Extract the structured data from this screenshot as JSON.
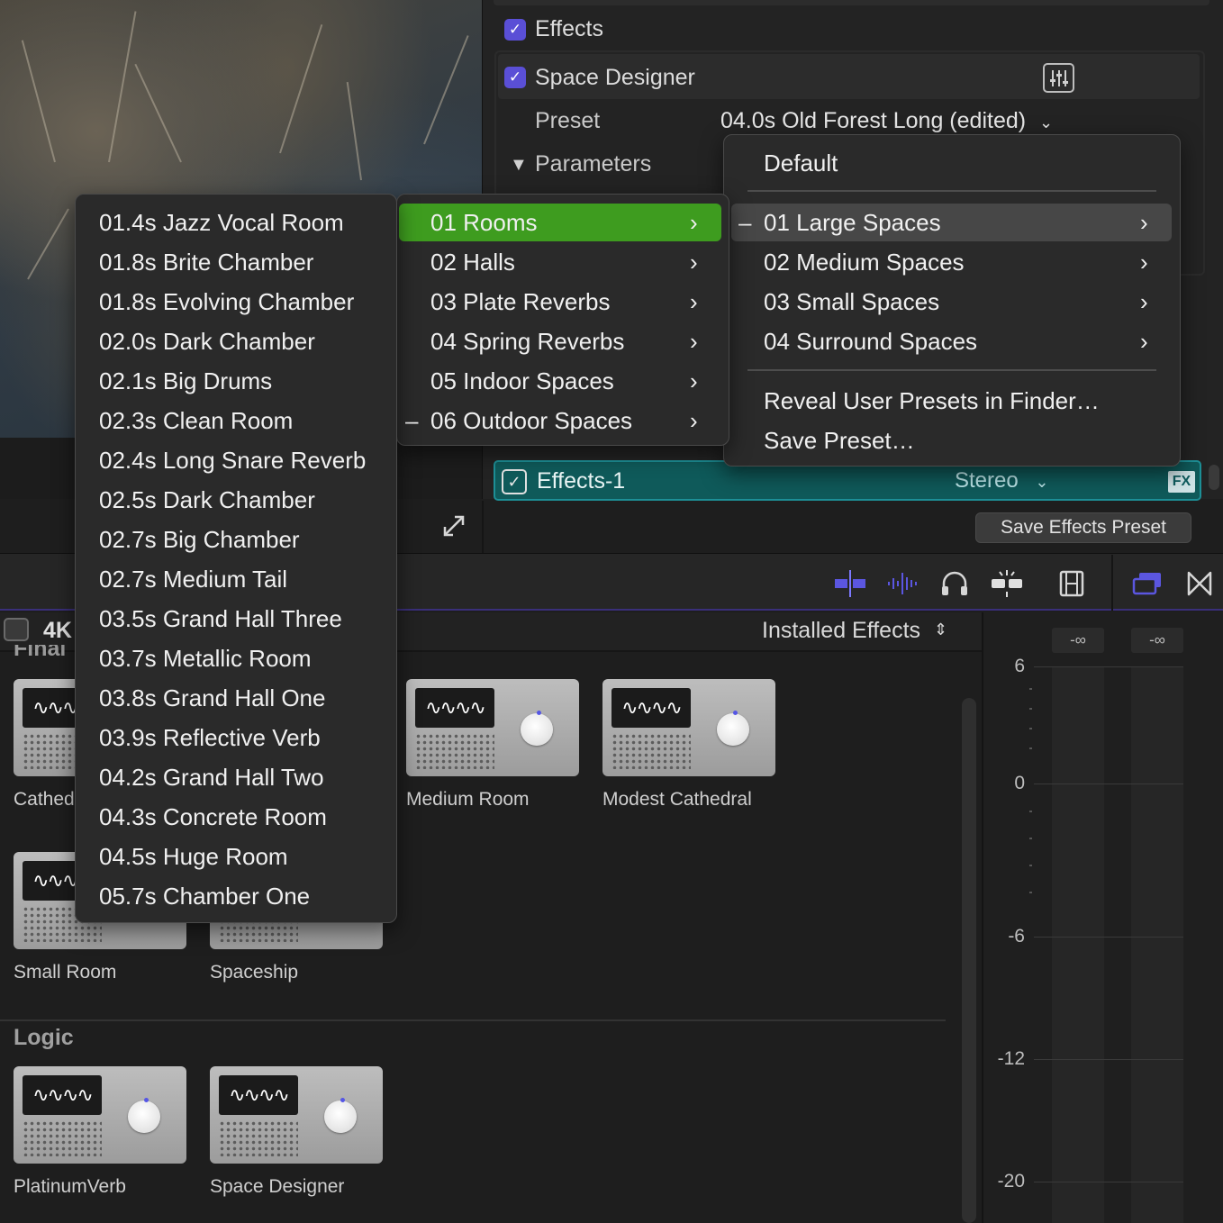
{
  "inspector": {
    "effects_label": "Effects",
    "space_designer_label": "Space Designer",
    "preset_label": "Preset",
    "preset_value": "04.0s Old Forest Long (edited)",
    "parameters_label": "Parameters",
    "effects1_label": "Effects-1",
    "channel_label": "Stereo",
    "fx_badge": "FX",
    "save_button": "Save Effects Preset"
  },
  "browser": {
    "partial_label": "4K",
    "partial_header": "Final",
    "source_selector": "Installed Effects",
    "section_logic": "Logic",
    "tiles": [
      {
        "label": "Cathedral"
      },
      {
        "label": "Medium Room"
      },
      {
        "label": "Modest Cathedral"
      },
      {
        "label": "Small Room"
      },
      {
        "label": "Spaceship"
      },
      {
        "label": "PlatinumVerb"
      },
      {
        "label": "Space Designer"
      }
    ]
  },
  "meters": {
    "peak_left": "-∞",
    "peak_right": "-∞",
    "scale": [
      "6",
      "0",
      "-6",
      "-12",
      "-20"
    ]
  },
  "menu_top": {
    "default": "Default",
    "items": [
      "01 Large Spaces",
      "02 Medium Spaces",
      "03 Small Spaces",
      "04 Surround Spaces"
    ],
    "reveal": "Reveal User Presets in Finder…",
    "save": "Save Preset…"
  },
  "menu_categories": {
    "items": [
      "01 Rooms",
      "02 Halls",
      "03 Plate Reverbs",
      "04 Spring Reverbs",
      "05 Indoor Spaces",
      "06 Outdoor Spaces"
    ]
  },
  "menu_presets": {
    "items": [
      "01.4s Jazz Vocal Room",
      "01.8s Brite Chamber",
      "01.8s Evolving Chamber",
      "02.0s Dark Chamber",
      "02.1s Big Drums",
      "02.3s Clean Room",
      "02.4s Long Snare Reverb",
      "02.5s Dark Chamber",
      "02.7s Big Chamber",
      "02.7s Medium Tail",
      "03.5s Grand Hall Three",
      "03.7s Metallic Room",
      "03.8s Grand Hall One",
      "03.9s Reflective Verb",
      "04.2s Grand Hall Two",
      "04.3s Concrete Room",
      "04.5s Huge Room",
      "05.7s Chamber One"
    ]
  },
  "colors": {
    "accent_purple": "#5a4fd6",
    "menu_highlight_green": "#3e9c1f",
    "fx_bar_teal": "#0f5a5a"
  },
  "icons": [
    "checkbox-icon",
    "equalizer-icon",
    "disclosure-triangle-icon",
    "expand-icon",
    "chevron-right-icon",
    "chevron-down-icon",
    "headphones-icon",
    "waveform-icon",
    "filmstrip-icon",
    "layers-icon",
    "bowtie-icon"
  ]
}
